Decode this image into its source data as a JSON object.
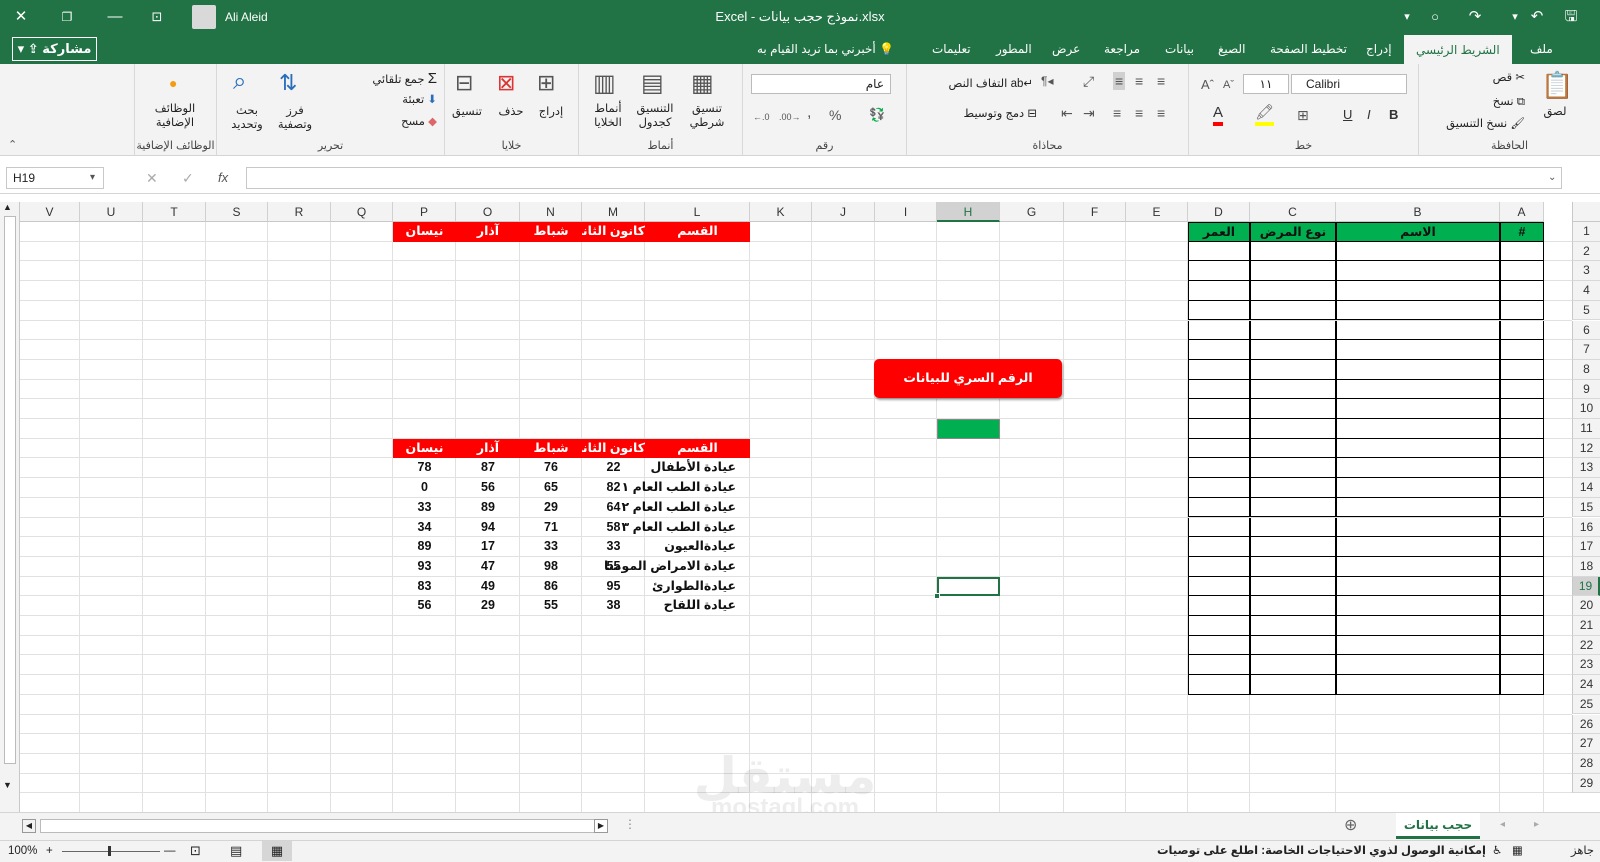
{
  "titlebar": {
    "filename": "نموذج حجب بيانات.xlsx",
    "app": "Excel",
    "user": "Ali Aleid",
    "share_label": "مشاركة"
  },
  "tabs": [
    "ملف",
    "الشريط الرئيسي",
    "إدراج",
    "تخطيط الصفحة",
    "الصيغ",
    "بيانات",
    "مراجعة",
    "عرض",
    "المطور",
    "تعليمات"
  ],
  "tell_me": "أخبرني بما تريد القيام به",
  "ribbon": {
    "clipboard": {
      "title": "الحافظة",
      "paste": "لصق",
      "cut": "قص",
      "copy": "نسخ",
      "format_painter": "نسخ التنسيق"
    },
    "font": {
      "title": "خط",
      "name": "Calibri",
      "size": "١١",
      "bold": "B",
      "italic": "I",
      "underline": "U"
    },
    "alignment": {
      "title": "محاذاة",
      "wrap": "التفاف النص",
      "merge": "دمج وتوسيط"
    },
    "number": {
      "title": "رقم",
      "format": "عام"
    },
    "styles": {
      "title": "أنماط",
      "conditional": "تنسيق شرطي",
      "as_table": "التنسيق كجدول",
      "cell_styles": "أنماط الخلايا"
    },
    "cells": {
      "title": "خلايا",
      "insert": "إدراج",
      "delete": "حذف",
      "format": "تنسيق"
    },
    "editing": {
      "title": "تحرير",
      "autosum": "جمع تلقائي",
      "fill": "تعبئة",
      "clear": "مسح",
      "sort": "فرز وتصفية",
      "find": "بحث وتحديد"
    },
    "addins": {
      "title": "الوظائف الإضافية",
      "label": "الوظائف الإضافية"
    }
  },
  "formula_bar": {
    "name_box": "H19",
    "fx": "fx",
    "formula": ""
  },
  "columns": [
    "A",
    "B",
    "C",
    "D",
    "E",
    "F",
    "G",
    "H",
    "I",
    "J",
    "K",
    "L",
    "M",
    "N",
    "O",
    "P",
    "Q",
    "R",
    "S",
    "T",
    "U",
    "V"
  ],
  "rows": [
    "1",
    "2",
    "3",
    "4",
    "5",
    "6",
    "7",
    "8",
    "9",
    "10",
    "11",
    "12",
    "13",
    "14",
    "15",
    "16",
    "17",
    "18",
    "19",
    "20",
    "21",
    "22",
    "23",
    "24",
    "25",
    "26",
    "27",
    "28",
    "29"
  ],
  "left_table": {
    "headers": [
      "#",
      "الاسم",
      "نوع المرض",
      "العمر"
    ]
  },
  "secret_button": "الرقم السري للبيانات",
  "top_table": {
    "headers": [
      "القسم",
      "كانون الثاني",
      "شباط",
      "آذار",
      "نيسان"
    ]
  },
  "data_table": {
    "headers": [
      "القسم",
      "كانون الثاني",
      "شباط",
      "آذار",
      "نيسان"
    ],
    "rows": [
      [
        "عيادة الأطفال",
        "22",
        "76",
        "87",
        "78"
      ],
      [
        "عيادة الطب العام ١",
        "82",
        "65",
        "56",
        "0"
      ],
      [
        "عيادة الطب العام ٢",
        "64",
        "29",
        "89",
        "33"
      ],
      [
        "عيادة الطب العام ٣",
        "58",
        "71",
        "94",
        "34"
      ],
      [
        "عيادةالعيون",
        "33",
        "33",
        "17",
        "89"
      ],
      [
        "عيادة الامراض المومنا",
        "55",
        "98",
        "47",
        "93"
      ],
      [
        "عيادةالطوارئ",
        "95",
        "86",
        "49",
        "83"
      ],
      [
        "عيادة اللقاح",
        "38",
        "55",
        "29",
        "56"
      ]
    ]
  },
  "sheet_tab": "حجب بيانات",
  "status": {
    "ready": "جاهز",
    "accessibility": "إمكانية الوصول لذوي الاحتياجات الخاصة: اطلع على توصيات",
    "zoom": "100%"
  },
  "watermark": {
    "ar": "مستقل",
    "en": "mostaql.com"
  },
  "colors": {
    "excel_green": "#217346",
    "header_red": "#ff0000",
    "cell_green": "#00b050"
  }
}
